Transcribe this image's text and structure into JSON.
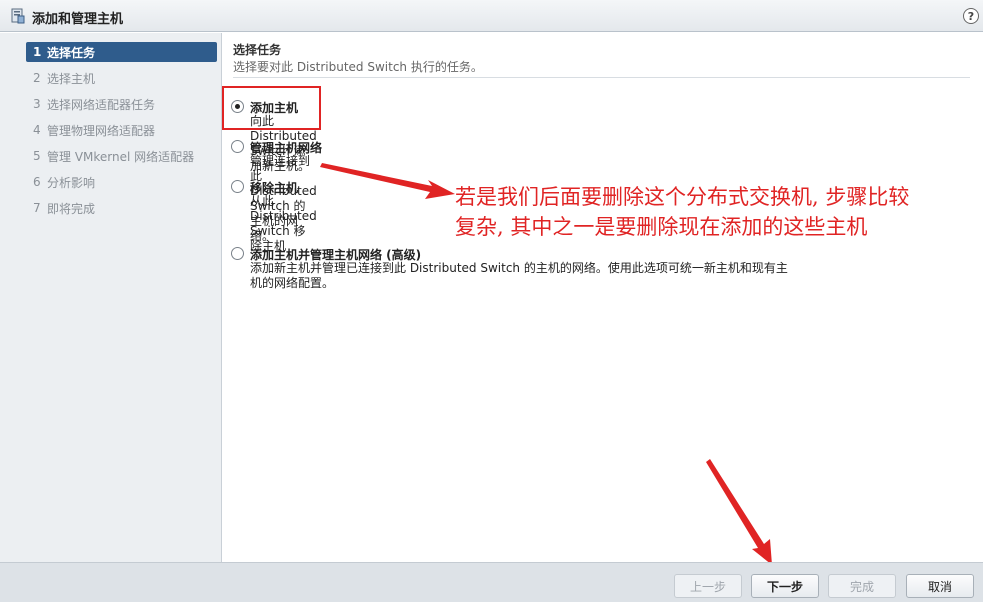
{
  "window": {
    "title": "添加和管理主机",
    "help_label": "?"
  },
  "steps": [
    {
      "num": "1",
      "label": "选择任务",
      "active": true
    },
    {
      "num": "2",
      "label": "选择主机",
      "active": false
    },
    {
      "num": "3",
      "label": "选择网络适配器任务",
      "active": false
    },
    {
      "num": "4",
      "label": "管理物理网络适配器",
      "active": false
    },
    {
      "num": "5",
      "label": "管理 VMkernel 网络适配器",
      "active": false
    },
    {
      "num": "6",
      "label": "分析影响",
      "active": false
    },
    {
      "num": "7",
      "label": "即将完成",
      "active": false
    }
  ],
  "main": {
    "title": "选择任务",
    "subtitle": "选择要对此 Distributed Switch 执行的任务。",
    "options": [
      {
        "label": "添加主机",
        "desc": "向此 Distributed Switch 添加新主机。",
        "checked": true
      },
      {
        "label": "管理主机网络",
        "desc": "管理连接到此 Distributed Switch 的主机的网络。",
        "checked": false
      },
      {
        "label": "移除主机",
        "desc": "从此 Distributed Switch 移除主机",
        "checked": false
      },
      {
        "label": "添加主机并管理主机网络 (高级)",
        "desc_line1": "添加新主机并管理已连接到此 Distributed Switch 的主机的网络。使用此选项可统一新主机和现有主",
        "desc_line2": "机的网络配置。",
        "checked": false
      }
    ]
  },
  "annotation": {
    "line1": "若是我们后面要删除这个分布式交换机, 步骤比较",
    "line2": "复杂, 其中之一是要删除现在添加的这些主机",
    "color": "#e02424"
  },
  "footer": {
    "back_label": "上一步",
    "next_label": "下一步",
    "finish_label": "完成",
    "cancel_label": "取消"
  },
  "colors": {
    "active_step": "#2f5c8c",
    "annotation_red": "#e02424"
  }
}
